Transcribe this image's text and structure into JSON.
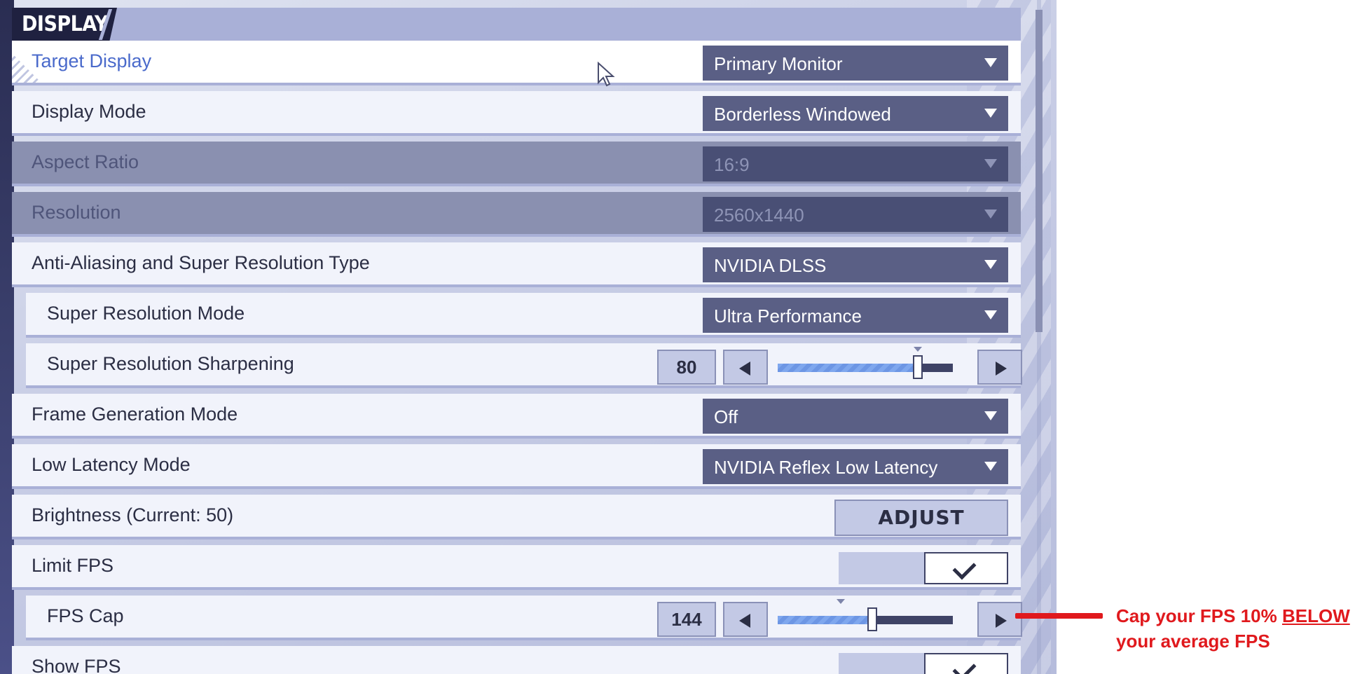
{
  "section": {
    "title": "DISPLAY"
  },
  "rows": {
    "target_display": {
      "label": "Target Display",
      "value": "Primary Monitor"
    },
    "display_mode": {
      "label": "Display Mode",
      "value": "Borderless Windowed"
    },
    "aspect_ratio": {
      "label": "Aspect Ratio",
      "value": "16:9",
      "disabled": true
    },
    "resolution": {
      "label": "Resolution",
      "value": "2560x1440",
      "disabled": true
    },
    "aa_type": {
      "label": "Anti-Aliasing and Super Resolution Type",
      "value": "NVIDIA DLSS"
    },
    "sr_mode": {
      "label": "Super Resolution Mode",
      "value": "Ultra Performance"
    },
    "sr_sharpening": {
      "label": "Super Resolution Sharpening",
      "value": "80",
      "slider_fraction": 0.8
    },
    "frame_gen": {
      "label": "Frame Generation Mode",
      "value": "Off"
    },
    "low_latency": {
      "label": "Low Latency Mode",
      "value": "NVIDIA Reflex Low Latency"
    },
    "brightness": {
      "label": "Brightness (Current: 50)",
      "button": "ADJUST"
    },
    "limit_fps": {
      "label": "Limit FPS",
      "checked": true
    },
    "fps_cap": {
      "label": "FPS Cap",
      "value": "144",
      "slider_fraction": 0.54
    },
    "show_fps": {
      "label": "Show FPS",
      "checked": true
    }
  },
  "annotation": {
    "text_1": "Cap your FPS 10% ",
    "text_em": "BELOW",
    "text_2": "your average FPS",
    "color": "#e0191d"
  },
  "colors": {
    "accent": "#4a6acb",
    "dropdown_bg": "#5a5f85",
    "header_bg": "#1f2140"
  }
}
